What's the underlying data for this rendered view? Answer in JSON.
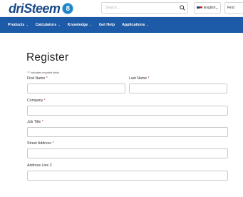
{
  "header": {
    "logo_text": "driSteem",
    "logo_badge": "8",
    "search_placeholder": "Search ...",
    "language_label": "English",
    "find_label": "Find"
  },
  "nav": {
    "items": [
      "Products",
      "Calculators",
      "Knowledge",
      "Get Help",
      "Applications"
    ],
    "has_dropdown": [
      true,
      true,
      true,
      false,
      true
    ]
  },
  "form": {
    "title": "Register",
    "required_note": "\"*\" indicates required fields",
    "required_marker": "*",
    "fields": {
      "first_name": "First Name",
      "last_name": "Last Name",
      "company": "Company",
      "job_title": "Job Title",
      "street_address": "Street Address",
      "address_line_2": "Address Line 2"
    }
  },
  "colors": {
    "nav_background": "#1d5aa8",
    "logo": "#1b4a8a",
    "required_marker": "#c0392b"
  }
}
